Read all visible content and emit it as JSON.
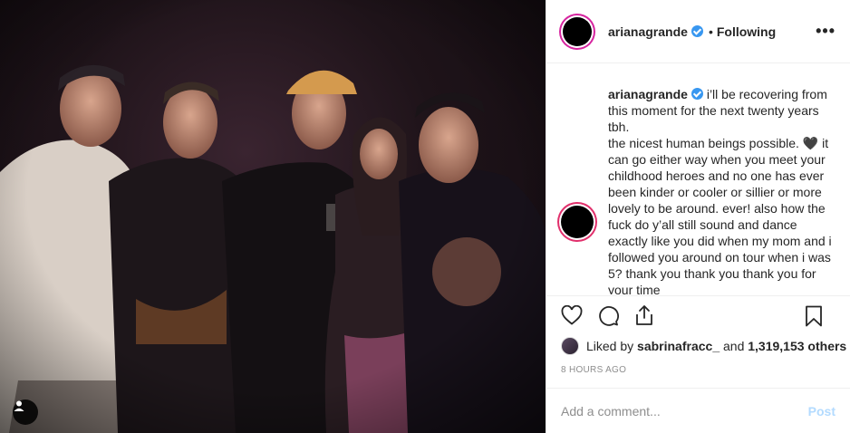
{
  "post": {
    "username": "arianagrande",
    "follow_separator": "•",
    "follow_label": "Following",
    "more_label": "•••",
    "caption_username": "arianagrande",
    "caption_lines": [
      "i’ll be recovering from this moment for the next twenty years tbh.",
      "the nicest human beings possible. 🖤 it can go either way when you meet your childhood heroes and no one has ever been kinder or cooler or sillier or more lovely to be around. ever! also how the fuck do y’all still sound and dance exactly like you did when my mom and i followed you around on tour when i was 5? thank you thank you thank you for your time"
    ],
    "likes": {
      "prefix": "Liked by",
      "liker": "sabrinafracc_",
      "connector": "and",
      "count": "1,319,153 others"
    },
    "time_ago": "8 HOURS AGO",
    "comment_placeholder": "Add a comment...",
    "post_label": "Post"
  },
  "icons": {
    "verified": "verified-badge-icon",
    "like": "heart-icon",
    "comment": "comment-bubble-icon",
    "share": "share-icon",
    "save": "bookmark-icon",
    "user_tag": "user-tag-icon"
  },
  "colors": {
    "verified": "#3897f0",
    "post_button_disabled": "#b3dbff",
    "story_ring": "#d6249f",
    "muted_text": "#8e8e8e"
  }
}
